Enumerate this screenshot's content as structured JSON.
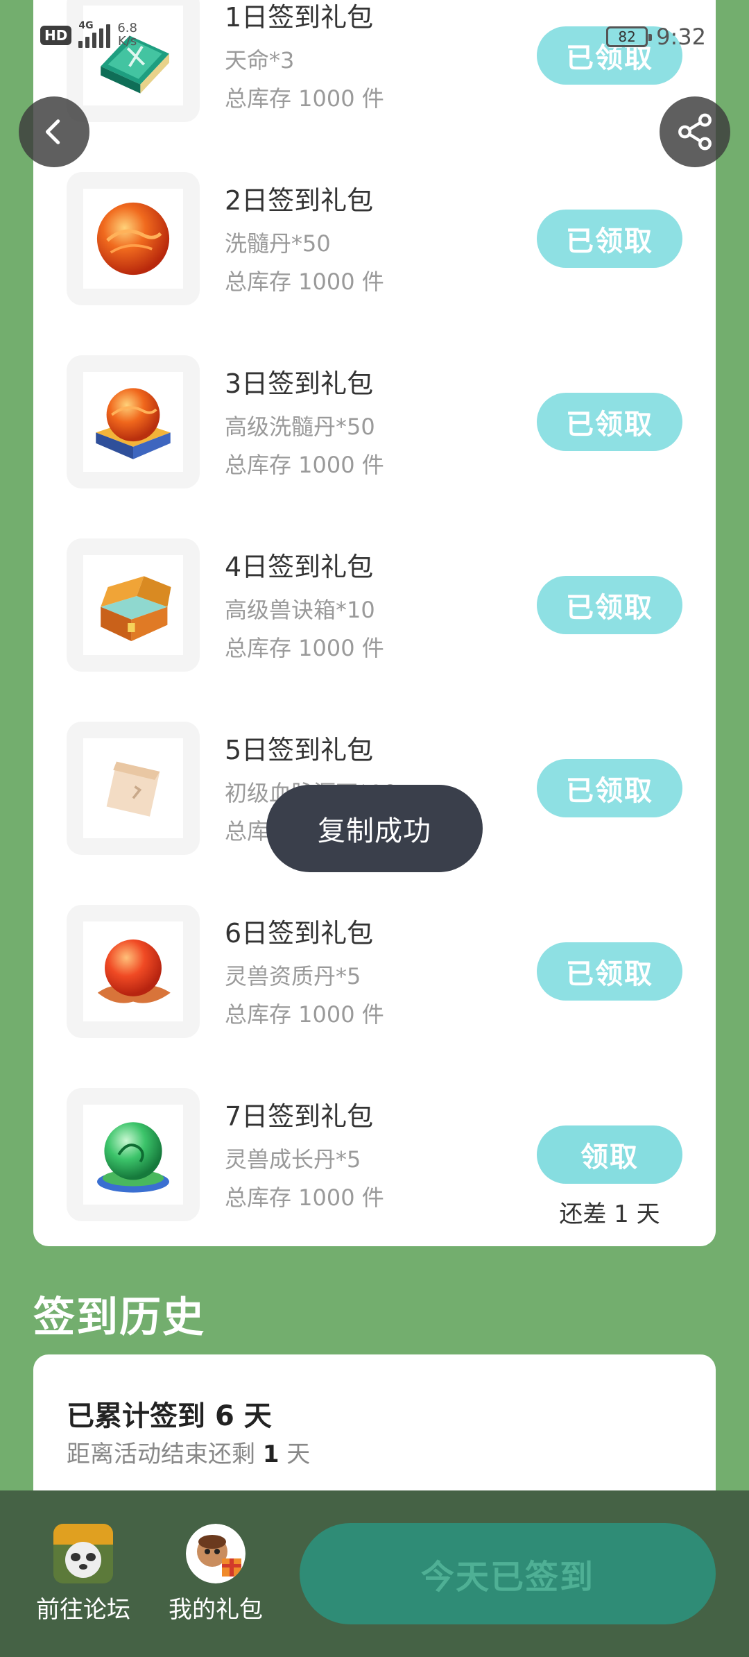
{
  "status_bar": {
    "hd": "HD",
    "network": "4G",
    "speed_value": "6.8",
    "speed_unit": "K/s",
    "battery": "82",
    "time": "9:32"
  },
  "nav": {
    "back_icon": "chevron-left-icon",
    "share_icon": "share-icon"
  },
  "gifts": [
    {
      "title": "1日签到礼包",
      "item": "天命*3",
      "stock": "总库存 1000 件",
      "button": "已领取",
      "icon": "book-icon"
    },
    {
      "title": "2日签到礼包",
      "item": "洗髓丹*50",
      "stock": "总库存 1000 件",
      "button": "已领取",
      "icon": "orb-icon"
    },
    {
      "title": "3日签到礼包",
      "item": "高级洗髓丹*50",
      "stock": "总库存 1000 件",
      "button": "已领取",
      "icon": "orb-stand-icon"
    },
    {
      "title": "4日签到礼包",
      "item": "高级兽诀箱*10",
      "stock": "总库存 1000 件",
      "button": "已领取",
      "icon": "chest-icon"
    },
    {
      "title": "5日签到礼包",
      "item": "初级血脉源石*10",
      "stock": "总库存 1000 件",
      "button": "已领取",
      "icon": "stone-icon"
    },
    {
      "title": "6日签到礼包",
      "item": "灵兽资质丹*5",
      "stock": "总库存 1000 件",
      "button": "已领取",
      "icon": "pill-icon"
    },
    {
      "title": "7日签到礼包",
      "item": "灵兽成长丹*5",
      "stock": "总库存 1000 件",
      "button": "领取",
      "note": "还差 1 天",
      "icon": "jade-orb-icon"
    }
  ],
  "toast": "复制成功",
  "history": {
    "heading": "签到历史",
    "total_prefix": "已累计签到 ",
    "total_days": "6",
    "total_suffix": " 天",
    "remain_prefix": "距离活动结束还剩 ",
    "remain_days": "1",
    "remain_suffix": " 天"
  },
  "bottom_bar": {
    "forum_label": "前往论坛",
    "gifts_label": "我的礼包",
    "signed_label": "今天已签到"
  }
}
